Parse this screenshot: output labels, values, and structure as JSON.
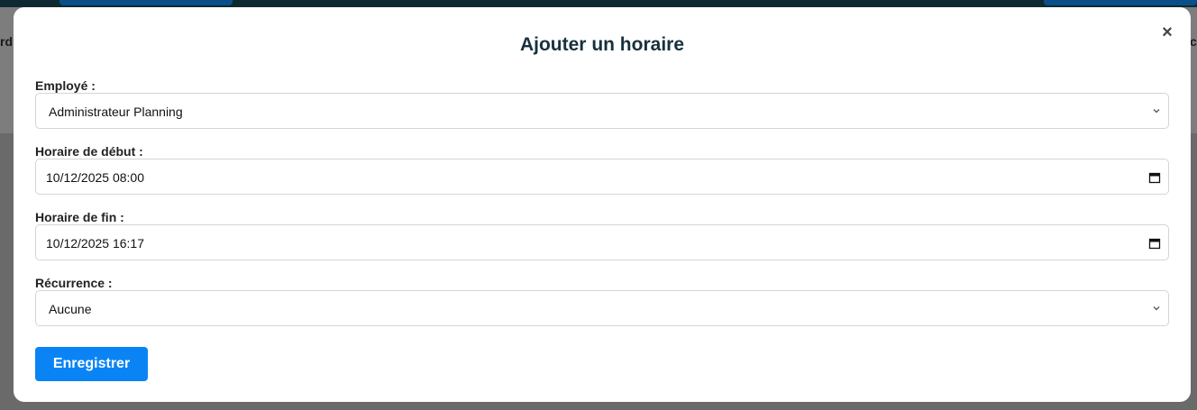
{
  "background": {
    "left_fragment": "rdi",
    "right_fragment": "c"
  },
  "modal": {
    "title": "Ajouter un horaire",
    "close_symbol": "×",
    "fields": {
      "employee": {
        "label": "Employé :",
        "value": "Administrateur Planning"
      },
      "start": {
        "label": "Horaire de début :",
        "value": "10/12/2025 08:00"
      },
      "end": {
        "label": "Horaire de fin :",
        "value": "10/12/2025 16:17"
      },
      "recurrence": {
        "label": "Récurrence :",
        "value": "Aucune"
      }
    },
    "save_label": "Enregistrer"
  },
  "icons": {
    "select_arrow": "chevron-down-icon",
    "date_picker": "calendar-icon",
    "close": "close-icon"
  },
  "colors": {
    "primary_button": "#0a84f5",
    "title": "#17313d",
    "overlay": "#6e6e6e"
  }
}
